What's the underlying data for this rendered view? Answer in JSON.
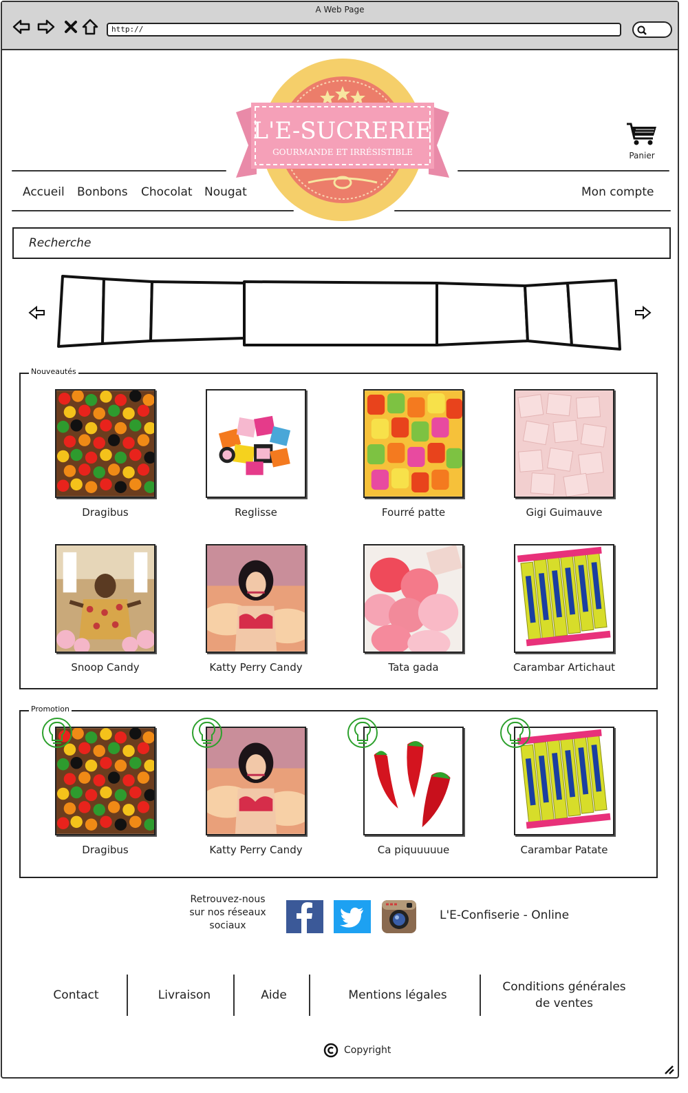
{
  "browser": {
    "title": "A Web Page",
    "url": "http://",
    "icons": [
      "back-icon",
      "forward-icon",
      "close-icon",
      "home-icon",
      "search-icon"
    ]
  },
  "logo": {
    "title": "L'E-SUCRERIE",
    "subtitle": "GOURMANDE ET IRRÉSISTIBLE",
    "colors": {
      "badge": "#f5cf6a",
      "inner": "#ec7d6a",
      "ribbon": "#f5a0b8",
      "stars": "#f7e6a0"
    }
  },
  "cart": {
    "label": "Panier",
    "icon": "cart-icon"
  },
  "menu": {
    "items": [
      "Accueil",
      "Bonbons",
      "Chocolat",
      "Nougat"
    ],
    "account": "Mon compte"
  },
  "search": {
    "placeholder": "Recherche"
  },
  "carousel": {
    "prev_icon": "arrow-left-icon",
    "next_icon": "arrow-right-icon"
  },
  "nouveautes": {
    "legend": "Nouveautés",
    "products": [
      {
        "name": "Dragibus",
        "image": "jelly-beans"
      },
      {
        "name": "Reglisse",
        "image": "licorice"
      },
      {
        "name": "Fourré patte",
        "image": "fruit-candy"
      },
      {
        "name": "Gigi Guimauve",
        "image": "marshmallow"
      },
      {
        "name": "Snoop Candy",
        "image": "snoop-photo"
      },
      {
        "name": "Katty Perry Candy",
        "image": "katy-photo"
      },
      {
        "name": "Tata gada",
        "image": "pink-tagada"
      },
      {
        "name": "Carambar Artichaut",
        "image": "carambar"
      }
    ]
  },
  "promotion": {
    "legend": "Promotion",
    "badge_icon": "lightbulb-icon",
    "badge_color": "#2ca02c",
    "products": [
      {
        "name": "Dragibus",
        "image": "jelly-beans"
      },
      {
        "name": "Katty Perry Candy",
        "image": "katy-photo"
      },
      {
        "name": "Ca piquuuuue",
        "image": "chili-candy"
      },
      {
        "name": "Carambar Patate",
        "image": "carambar"
      }
    ]
  },
  "social": {
    "text": [
      "Retrouvez-nous",
      "sur nos réseaux",
      "sociaux"
    ],
    "networks": [
      {
        "name": "facebook-icon",
        "color": "#3b5998"
      },
      {
        "name": "twitter-icon",
        "color": "#1da1f2"
      },
      {
        "name": "instagram-icon",
        "color": "#8a6a4f"
      }
    ],
    "brand": "L'E-Confiserie - Online"
  },
  "footer": {
    "links": [
      "Contact",
      "Livraison",
      "Aide",
      "Mentions légales",
      "Conditions générales de ventes"
    ],
    "cgv_lines": [
      "Conditions générales",
      "de ventes"
    ],
    "copyright": "Copyright"
  }
}
